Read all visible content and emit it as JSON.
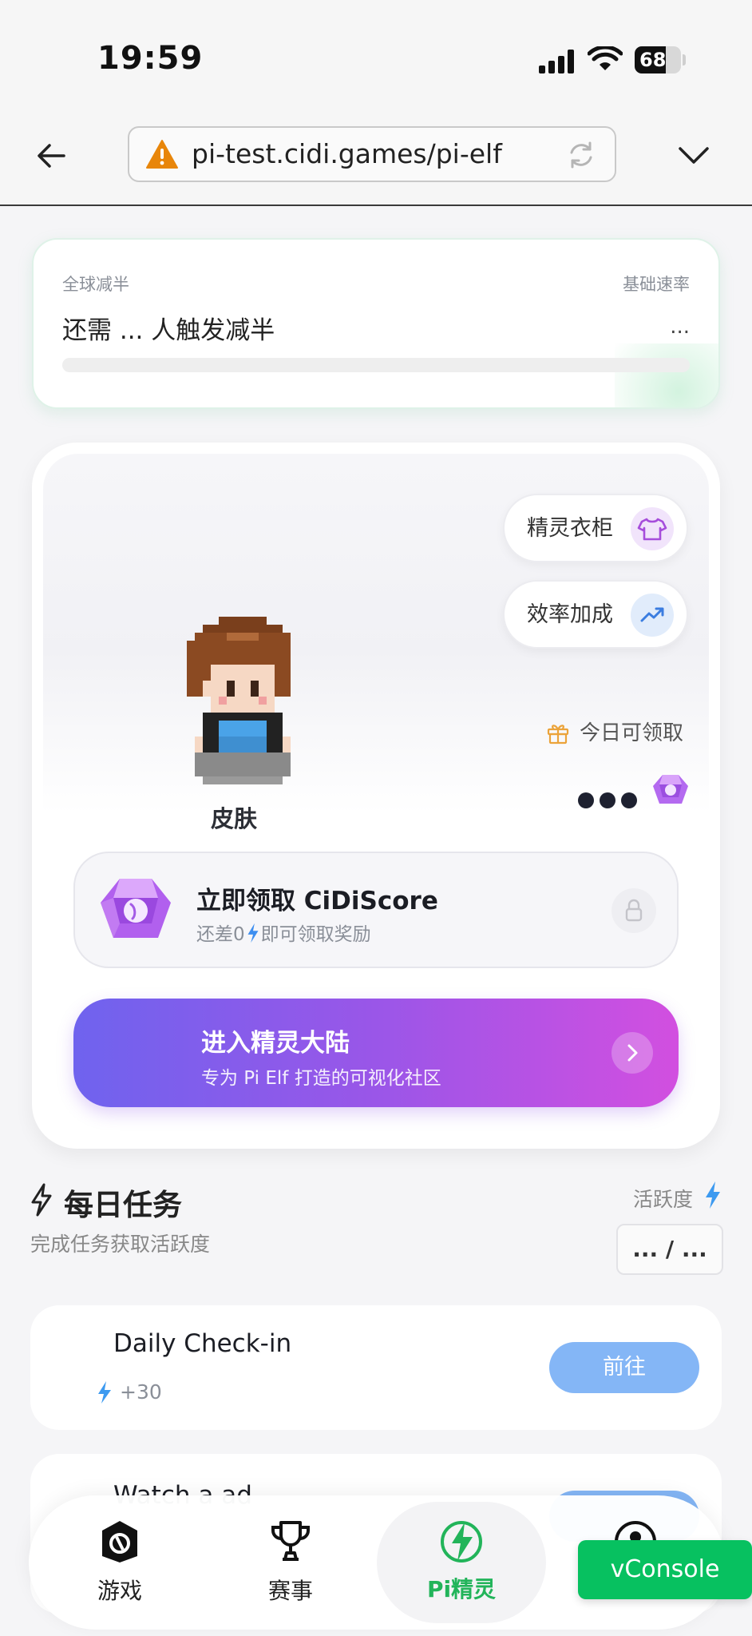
{
  "status_bar": {
    "time": "19:59",
    "battery": "68"
  },
  "browser": {
    "url": "pi-test.cidi.games/pi-elf"
  },
  "halving": {
    "left_label": "全球减半",
    "right_label": "基础速率",
    "remaining_text": "还需 ... 人触发减半",
    "rate_value": "...",
    "progress": 0
  },
  "elf": {
    "wardrobe_label": "精灵衣柜",
    "boost_label": "效率加成",
    "skin_label": "皮肤",
    "gift_label": "今日可领取",
    "claim": {
      "title": "立即领取 CiDiScore",
      "subtitle_pre": "还差0",
      "subtitle_post": "即可领取奖励"
    },
    "enter": {
      "title": "进入精灵大陆",
      "subtitle": "专为 Pi Elf 打造的可视化社区"
    }
  },
  "daily_tasks": {
    "title": "每日任务",
    "subtitle": "完成任务获取活跃度",
    "activity_label": "活跃度",
    "activity_value": "... / ...",
    "tasks": [
      {
        "name": "Daily Check-in",
        "reward": "+30",
        "button": "前往"
      },
      {
        "name": "Watch a ad",
        "reward": "",
        "button": ""
      }
    ]
  },
  "nav": {
    "items": [
      {
        "label": "游戏"
      },
      {
        "label": "赛事"
      },
      {
        "label": "Pi精灵"
      },
      {
        "label": ""
      }
    ]
  },
  "vconsole": "vConsole",
  "colors": {
    "accent_green": "#22b45a",
    "claim_gradient": [
      "#6f63ee",
      "#d24fe0"
    ],
    "go_button": "#84b6f6",
    "vconsole": "#07c160"
  }
}
